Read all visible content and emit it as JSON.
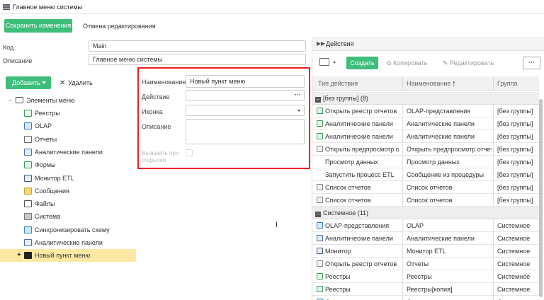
{
  "window": {
    "title": "Главное меню системы",
    "icon": "menu-list-icon"
  },
  "toolbar": {
    "save_label": "Сохранить изменения",
    "cancel_label": "Отмена редактирования",
    "accent": "#3ebd7b"
  },
  "form": {
    "code_label": "Код",
    "code_value": "Main",
    "desc_label": "Описание",
    "desc_value": "Главное меню системы"
  },
  "tree_toolbar": {
    "add_label": "Добавить",
    "delete_label": "Удалить"
  },
  "tree": {
    "root": {
      "label": "Элементы меню",
      "icon": "folder-icon"
    },
    "items": [
      {
        "label": "Реестры",
        "icon": "registry-icon"
      },
      {
        "label": "OLAP",
        "icon": "olap-icon"
      },
      {
        "label": "Отчеты",
        "icon": "reports-icon"
      },
      {
        "label": "Аналитические панели",
        "icon": "analytics-panel-icon"
      },
      {
        "label": "Формы",
        "icon": "forms-icon"
      },
      {
        "label": "Монитор ETL",
        "icon": "monitor-icon"
      },
      {
        "label": "Сообщения",
        "icon": "messages-icon"
      },
      {
        "label": "Файлы",
        "icon": "files-icon"
      },
      {
        "label": "Система",
        "icon": "tools-icon"
      },
      {
        "label": "Синхронизировать схему",
        "icon": "sync-icon"
      },
      {
        "label": "Аналитические панели",
        "icon": "analytics-panel-icon"
      },
      {
        "label": "Новый пункт меню",
        "icon": "list-icon",
        "selected": true
      }
    ]
  },
  "popup": {
    "name_label": "Наименование",
    "name_value": "Новый пункт меню",
    "action_label": "Действие",
    "action_value": "",
    "icon_label": "Иконка",
    "icon_value": "",
    "desc_label": "Описание",
    "desc_value": "",
    "open_label_1": "Вызывать при",
    "open_label_2": "открытии",
    "border_color": "#e22222"
  },
  "actions": {
    "title": "Действия",
    "create_label": "Создать",
    "copy_label": "Копировать",
    "edit_label": "Редактировать",
    "more_label": "···",
    "columns": [
      "Тип действия",
      "Наименование",
      "Группа"
    ],
    "groups": [
      {
        "label": "[без группы] (8)",
        "rows": [
          {
            "type": "Открыть реестр отчетов",
            "name": "OLAP-представления",
            "group": "[без группы]",
            "icon": "registry-icon"
          },
          {
            "type": "Аналитические панели",
            "name": "Аналитические панели",
            "group": "[без группы]",
            "icon": "registry-icon"
          },
          {
            "type": "Аналитические панели",
            "name": "Аналитические панели",
            "group": "[без группы]",
            "icon": "registry-icon"
          },
          {
            "type": "Открыть предпросмотр о...",
            "name": "Открыть предпросмотр отчета",
            "group": "[без группы]",
            "icon": "doc-icon"
          },
          {
            "type": "Просмотр данных",
            "name": "Просмотр данных",
            "group": "[без группы]",
            "icon": ""
          },
          {
            "type": "Запустить процесс ETL",
            "name": "Сообщение из процедуры",
            "group": "[без группы]",
            "icon": ""
          },
          {
            "type": "Список отчетов",
            "name": "Список отчетов",
            "group": "[без группы]",
            "icon": "doc-icon"
          },
          {
            "type": "Список отчетов",
            "name": "Список отчетов",
            "group": "[без группы]",
            "icon": "doc-icon"
          }
        ]
      },
      {
        "label": "Системное (11)",
        "rows": [
          {
            "type": "OLAP-представления",
            "name": "OLAP",
            "group": "Системное",
            "icon": "olap-icon"
          },
          {
            "type": "Аналитические панели",
            "name": "Аналитические панели",
            "group": "Системное",
            "icon": "analytics-panel-icon"
          },
          {
            "type": "Монитор",
            "name": "Монитор ETL",
            "group": "Системное",
            "icon": "monitor-icon"
          },
          {
            "type": "Открыть реестр отчетов",
            "name": "Отчеты",
            "group": "Системное",
            "icon": "doc-icon"
          },
          {
            "type": "Реестры",
            "name": "Реестры",
            "group": "Системное",
            "icon": "registry-icon"
          },
          {
            "type": "Реестры",
            "name": "Реестры[копия]",
            "group": "Системное",
            "icon": "registry-icon"
          },
          {
            "type": "Синхронизировать схему",
            "name": "Синхронизировать схему",
            "group": "Системное",
            "icon": "sync-icon"
          }
        ]
      }
    ]
  }
}
